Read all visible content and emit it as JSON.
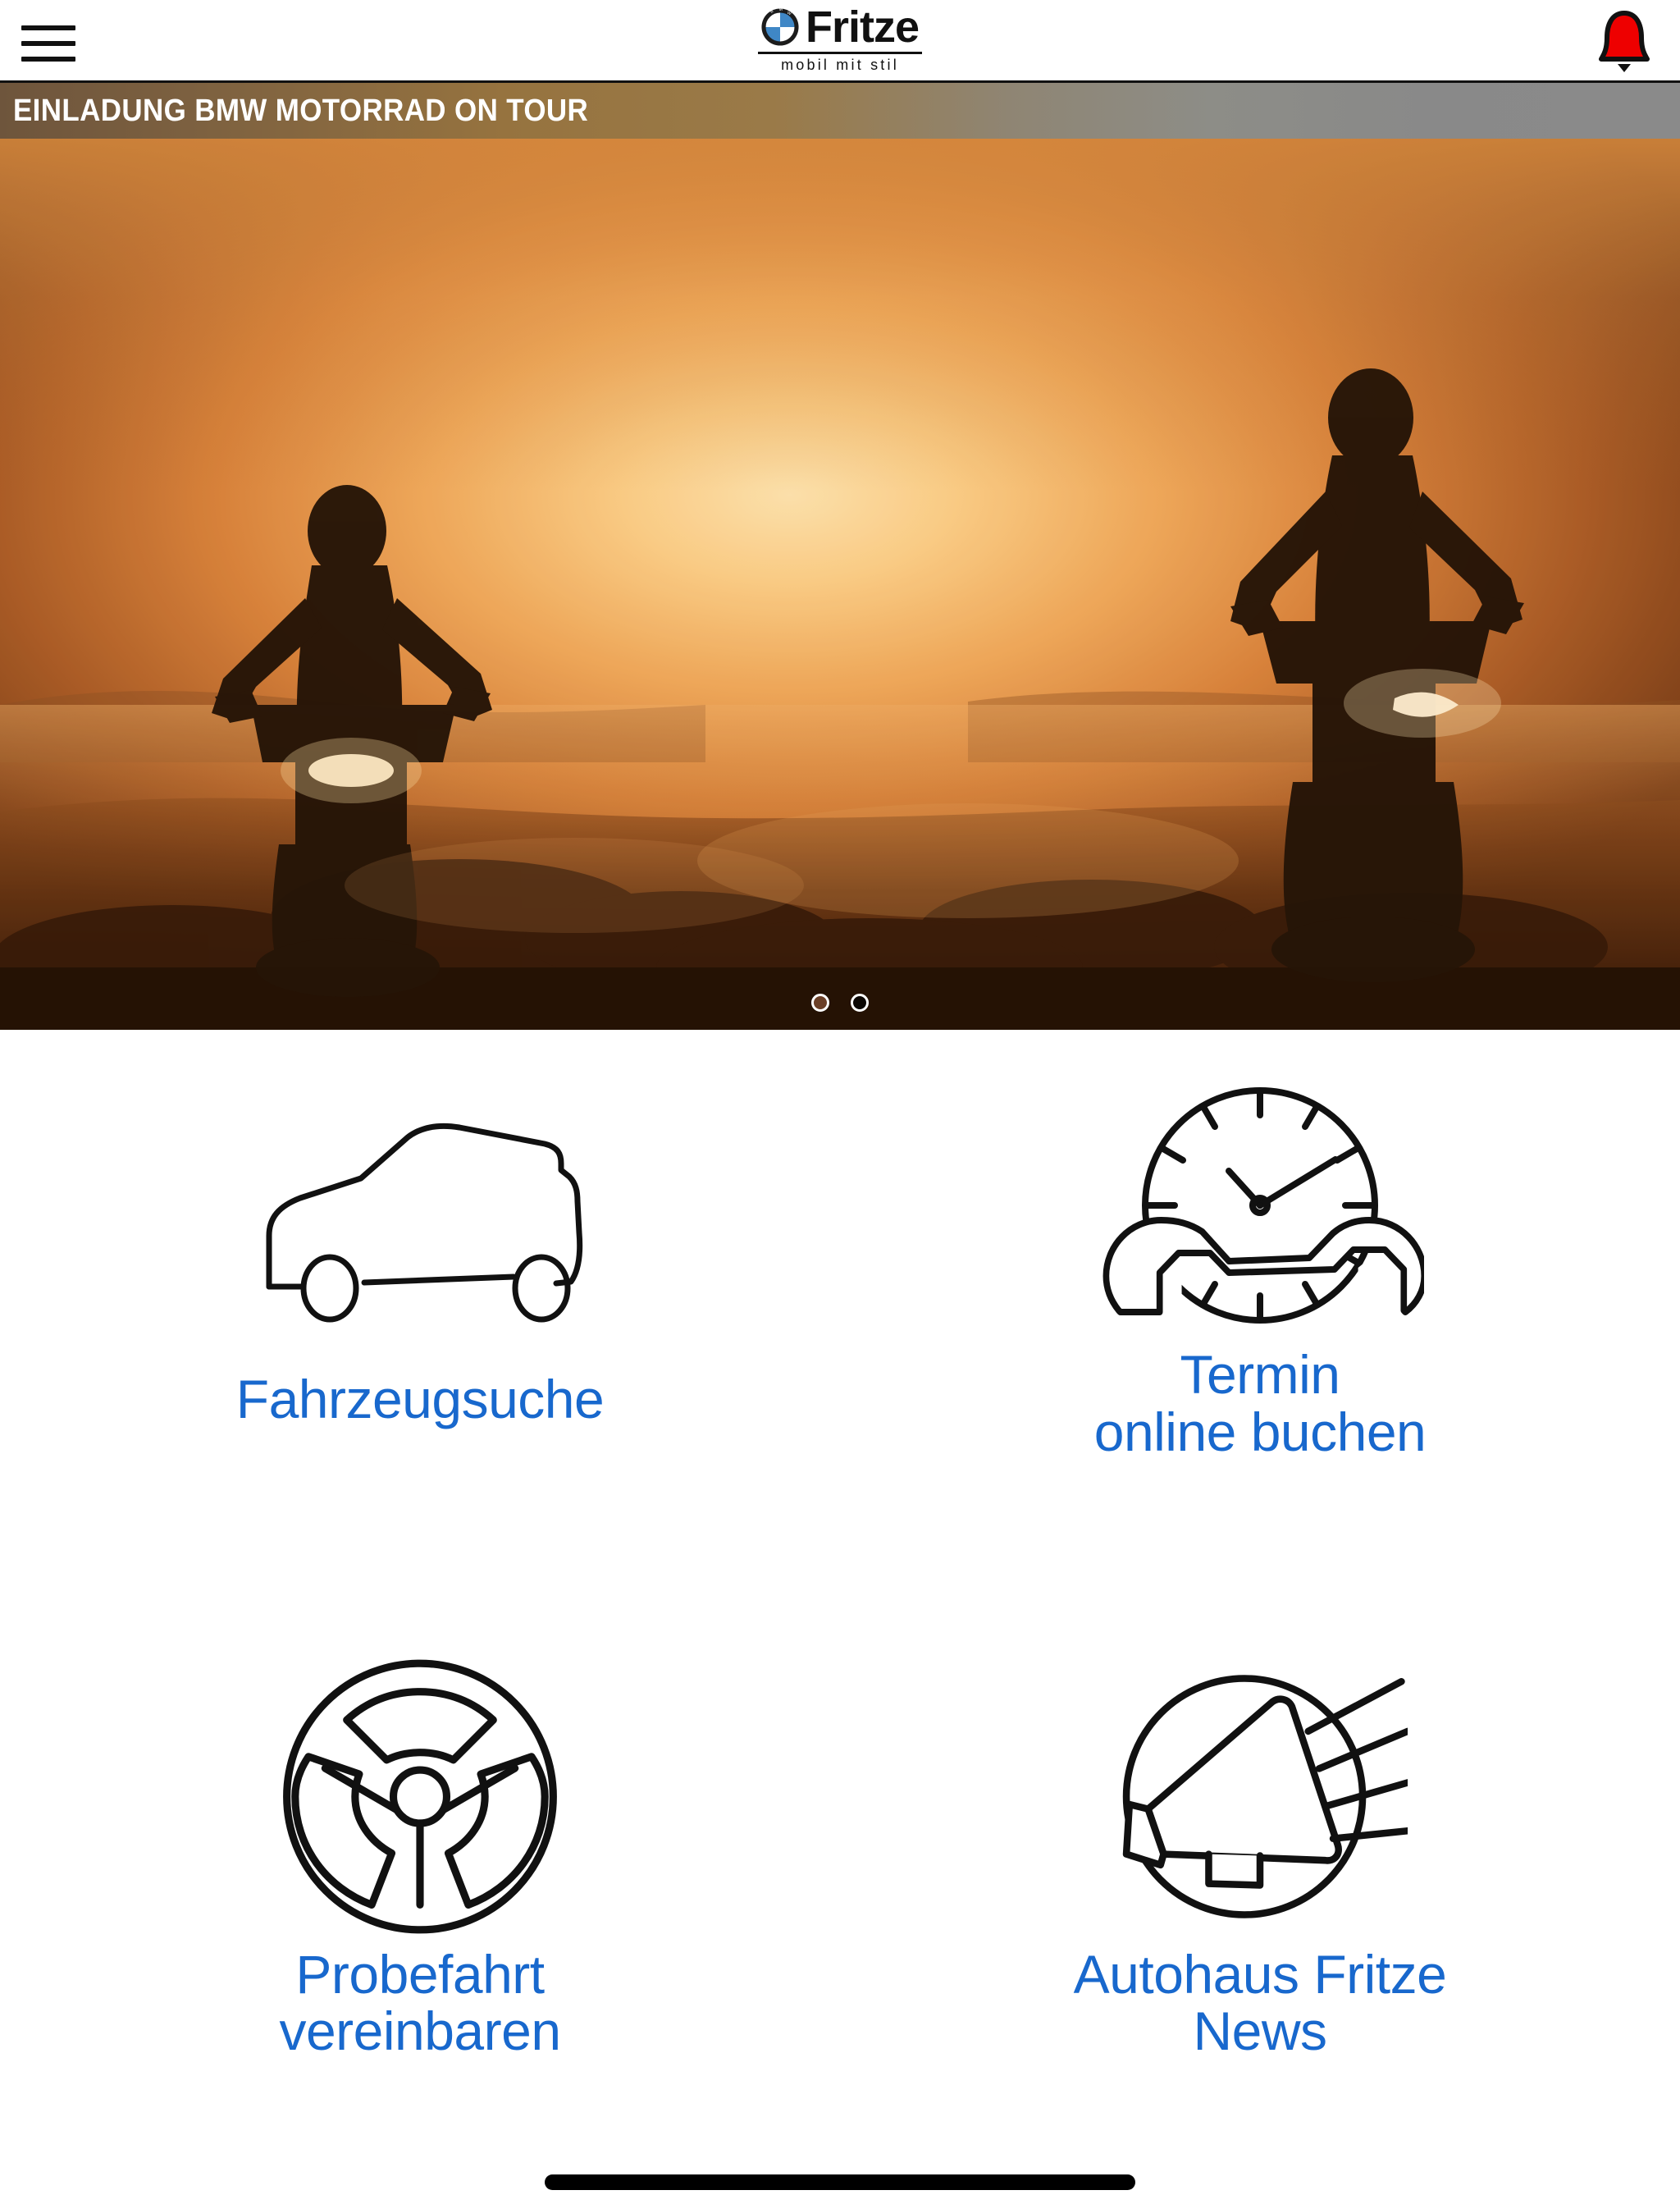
{
  "header": {
    "menu_icon": "hamburger-menu-icon",
    "brand_name": "Fritze",
    "brand_tagline": "mobil mit stil",
    "brand_logo_icon": "bmw-roundel-icon",
    "notification_icon": "bell-icon",
    "notification_color": "#ee0000"
  },
  "banner": {
    "text": "EINLADUNG BMW MOTORRAD ON TOUR",
    "text_color": "#ffffff",
    "gradient_start": "#6e553c",
    "gradient_end": "#8a8a8a"
  },
  "hero": {
    "description": "Two motorcycle riders silhouetted against an orange sunset with dust",
    "carousel": {
      "dots": [
        {
          "state": "inactive"
        },
        {
          "state": "active"
        }
      ]
    }
  },
  "tiles": [
    {
      "icon": "car-side-icon",
      "label_line1": "Fahrzeugsuche",
      "label_line2": "",
      "color": "#1868cd"
    },
    {
      "icon": "clock-wrench-icon",
      "label_line1": "Termin",
      "label_line2": "online buchen",
      "color": "#1868cd"
    },
    {
      "icon": "steering-wheel-icon",
      "label_line1": "Probefahrt",
      "label_line2": "vereinbaren",
      "color": "#1868cd"
    },
    {
      "icon": "megaphone-icon",
      "label_line1": "Autohaus Fritze",
      "label_line2": "News",
      "color": "#1868cd"
    }
  ],
  "system": {
    "home_indicator": "home-indicator-bar"
  }
}
